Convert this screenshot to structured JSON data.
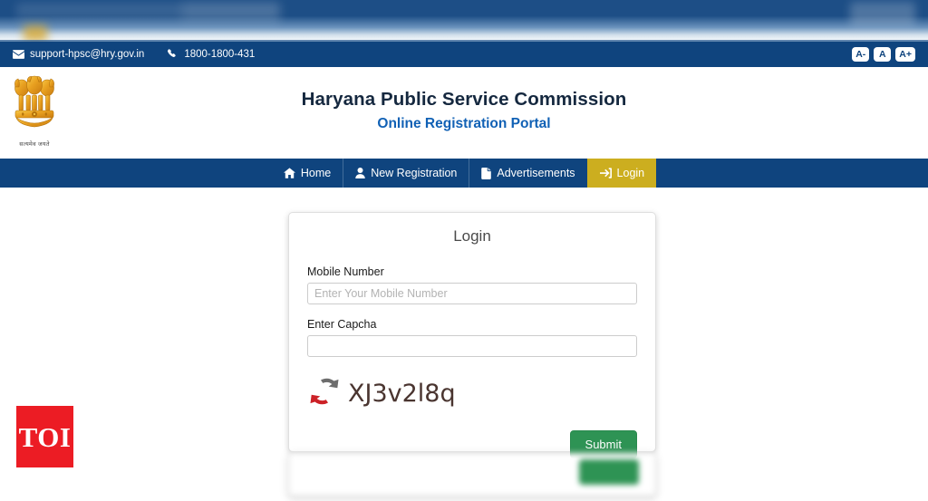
{
  "topbar": {
    "email": "support-hpsc@hry.gov.in",
    "phone": "1800-1800-431",
    "font_decrease": "A-",
    "font_normal": "A",
    "font_increase": "A+"
  },
  "masthead": {
    "emblem_motto": "सत्यमेव जयते",
    "title": "Haryana Public Service Commission",
    "subtitle": "Online Registration Portal"
  },
  "nav": {
    "items": [
      {
        "label": "Home",
        "icon": "home-icon",
        "active": false
      },
      {
        "label": "New Registration",
        "icon": "user-icon",
        "active": false
      },
      {
        "label": "Advertisements",
        "icon": "document-icon",
        "active": false
      },
      {
        "label": "Login",
        "icon": "sign-in-icon",
        "active": true
      }
    ]
  },
  "login_card": {
    "title": "Login",
    "mobile_label": "Mobile Number",
    "mobile_placeholder": "Enter Your Mobile Number",
    "mobile_value": "",
    "captcha_label": "Enter Capcha",
    "captcha_placeholder": "",
    "captcha_value": "",
    "captcha_code": "XJ3v2l8q",
    "refresh_icon": "refresh-captcha-icon",
    "submit_label": "Submit"
  },
  "watermark": {
    "label": "TOI"
  },
  "colors": {
    "navy": "#0f447e",
    "gold": "#ccae1f",
    "green": "#2e9354",
    "link_blue": "#1161b5",
    "toi_red": "#ec1c24"
  }
}
